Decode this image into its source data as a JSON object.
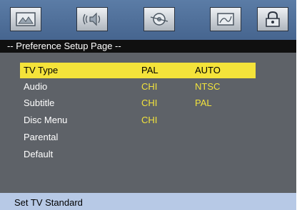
{
  "toolbar": {
    "icons": [
      {
        "name": "general-setup-icon"
      },
      {
        "name": "audio-setup-icon"
      },
      {
        "name": "video-setup-icon"
      },
      {
        "name": "preference-setup-icon"
      },
      {
        "name": "password-setup-icon"
      }
    ]
  },
  "page_title": "-- Preference Setup Page --",
  "menu": {
    "rows": [
      {
        "label": "TV Type",
        "value": "PAL",
        "option": "AUTO",
        "selected": true
      },
      {
        "label": "Audio",
        "value": "CHI",
        "option": "NTSC"
      },
      {
        "label": "Subtitle",
        "value": "CHI",
        "option": "PAL"
      },
      {
        "label": "Disc Menu",
        "value": "CHI",
        "option": ""
      },
      {
        "label": "Parental",
        "value": "",
        "option": ""
      },
      {
        "label": "Default",
        "value": "",
        "option": ""
      }
    ]
  },
  "colors": {
    "highlight": "#f4e33a",
    "value_text": "#f2e33c",
    "panel_bg": "#5e6268",
    "status_bg": "#b7c9e6"
  },
  "status": {
    "text": "Set TV Standard"
  }
}
